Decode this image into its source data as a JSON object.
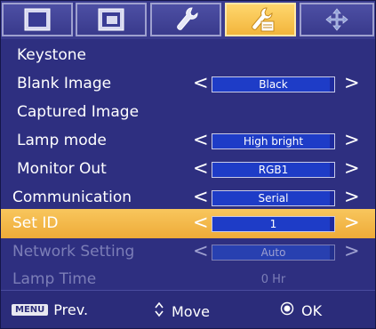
{
  "tabs": [
    {
      "icon": "screen-icon",
      "active": false
    },
    {
      "icon": "picture-in-picture-icon",
      "active": false
    },
    {
      "icon": "wrench-icon",
      "active": false
    },
    {
      "icon": "wrench-settings-icon",
      "active": true
    },
    {
      "icon": "arrows-move-icon",
      "active": false
    }
  ],
  "menu": {
    "items": [
      {
        "label": "Keystone"
      },
      {
        "label": "Blank Image",
        "value": "Black"
      },
      {
        "label": "Captured Image"
      },
      {
        "label": "Lamp mode",
        "value": "High bright"
      },
      {
        "label": "Monitor Out",
        "value": "RGB1"
      },
      {
        "label": "Communication",
        "value": "Serial"
      },
      {
        "label": "Set ID",
        "value": "1"
      },
      {
        "label": "Network Setting",
        "value": "Auto"
      },
      {
        "label": "Lamp Time",
        "value": "0 Hr"
      }
    ],
    "arrow_left": "<",
    "arrow_right": ">"
  },
  "footer": {
    "menu_badge": "MENU",
    "prev_label": "Prev.",
    "move_label": "Move",
    "ok_label": "OK"
  },
  "colors": {
    "panel": "#2e2f80",
    "selected_row": "#f2b53c",
    "value_fill": "#1e3cc7",
    "disabled_text": "#7c7eb7"
  }
}
